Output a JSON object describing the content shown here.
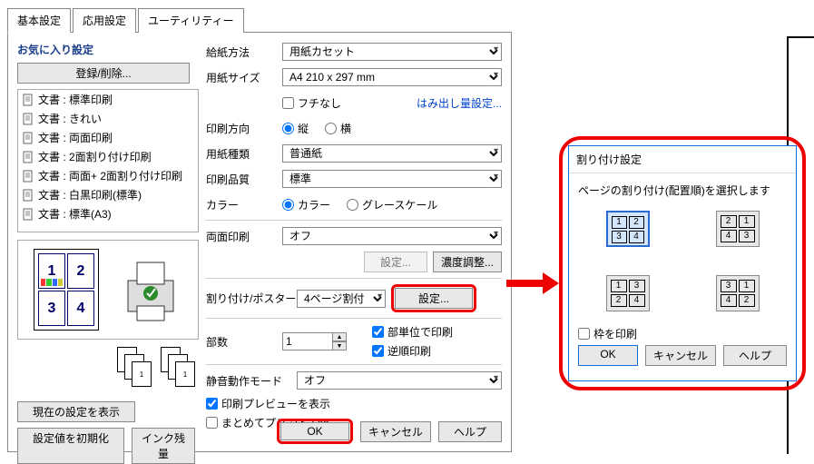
{
  "tabs": {
    "basic": "基本設定",
    "advanced": "応用設定",
    "utility": "ユーティリティー"
  },
  "favorites": {
    "title": "お気に入り設定",
    "register_btn": "登録/削除...",
    "docs": [
      {
        "label": "文書 : 標準印刷"
      },
      {
        "label": "文書 : きれい"
      },
      {
        "label": "文書 : 両面印刷"
      },
      {
        "label": "文書 : 2面割り付け印刷"
      },
      {
        "label": "文書 : 両面+ 2面割り付け印刷"
      },
      {
        "label": "文書 : 白黒印刷(標準)"
      },
      {
        "label": "文書 : 標準(A3)"
      }
    ],
    "show_current": "現在の設定を表示",
    "reset": "設定値を初期化",
    "ink": "インク残量"
  },
  "form": {
    "paper_source": {
      "label": "給紙方法",
      "value": "用紙カセット"
    },
    "paper_size": {
      "label": "用紙サイズ",
      "value": "A4 210 x 297 mm"
    },
    "borderless": {
      "label": "フチなし",
      "link": "はみ出し量設定..."
    },
    "orientation": {
      "label": "印刷方向",
      "portrait": "縦",
      "landscape": "横"
    },
    "paper_type": {
      "label": "用紙種類",
      "value": "普通紙"
    },
    "quality": {
      "label": "印刷品質",
      "value": "標準"
    },
    "color": {
      "label": "カラー",
      "color": "カラー",
      "gray": "グレースケール"
    },
    "duplex": {
      "label": "両面印刷",
      "value": "オフ",
      "settings": "設定...",
      "density": "濃度調整..."
    },
    "layout": {
      "label": "割り付け/ポスター",
      "value": "4ページ割付",
      "settings": "設定..."
    },
    "copies": {
      "label": "部数",
      "value": "1",
      "collate": "部単位で印刷",
      "reverse": "逆順印刷"
    },
    "quiet": {
      "label": "静音動作モード",
      "value": "オフ"
    },
    "preview": "印刷プレビューを表示",
    "lite": "まとめてプリント Lite"
  },
  "buttons": {
    "ok": "OK",
    "cancel": "キャンセル",
    "help": "ヘルプ"
  },
  "dialog": {
    "title": "割り付け設定",
    "instruction": "ページの割り付け(配置順)を選択します",
    "frame": "枠を印刷",
    "orders": {
      "a": [
        "1",
        "2",
        "3",
        "4"
      ],
      "b": [
        "2",
        "1",
        "4",
        "3"
      ],
      "c": [
        "1",
        "3",
        "2",
        "4"
      ],
      "d": [
        "3",
        "1",
        "4",
        "2"
      ]
    }
  }
}
